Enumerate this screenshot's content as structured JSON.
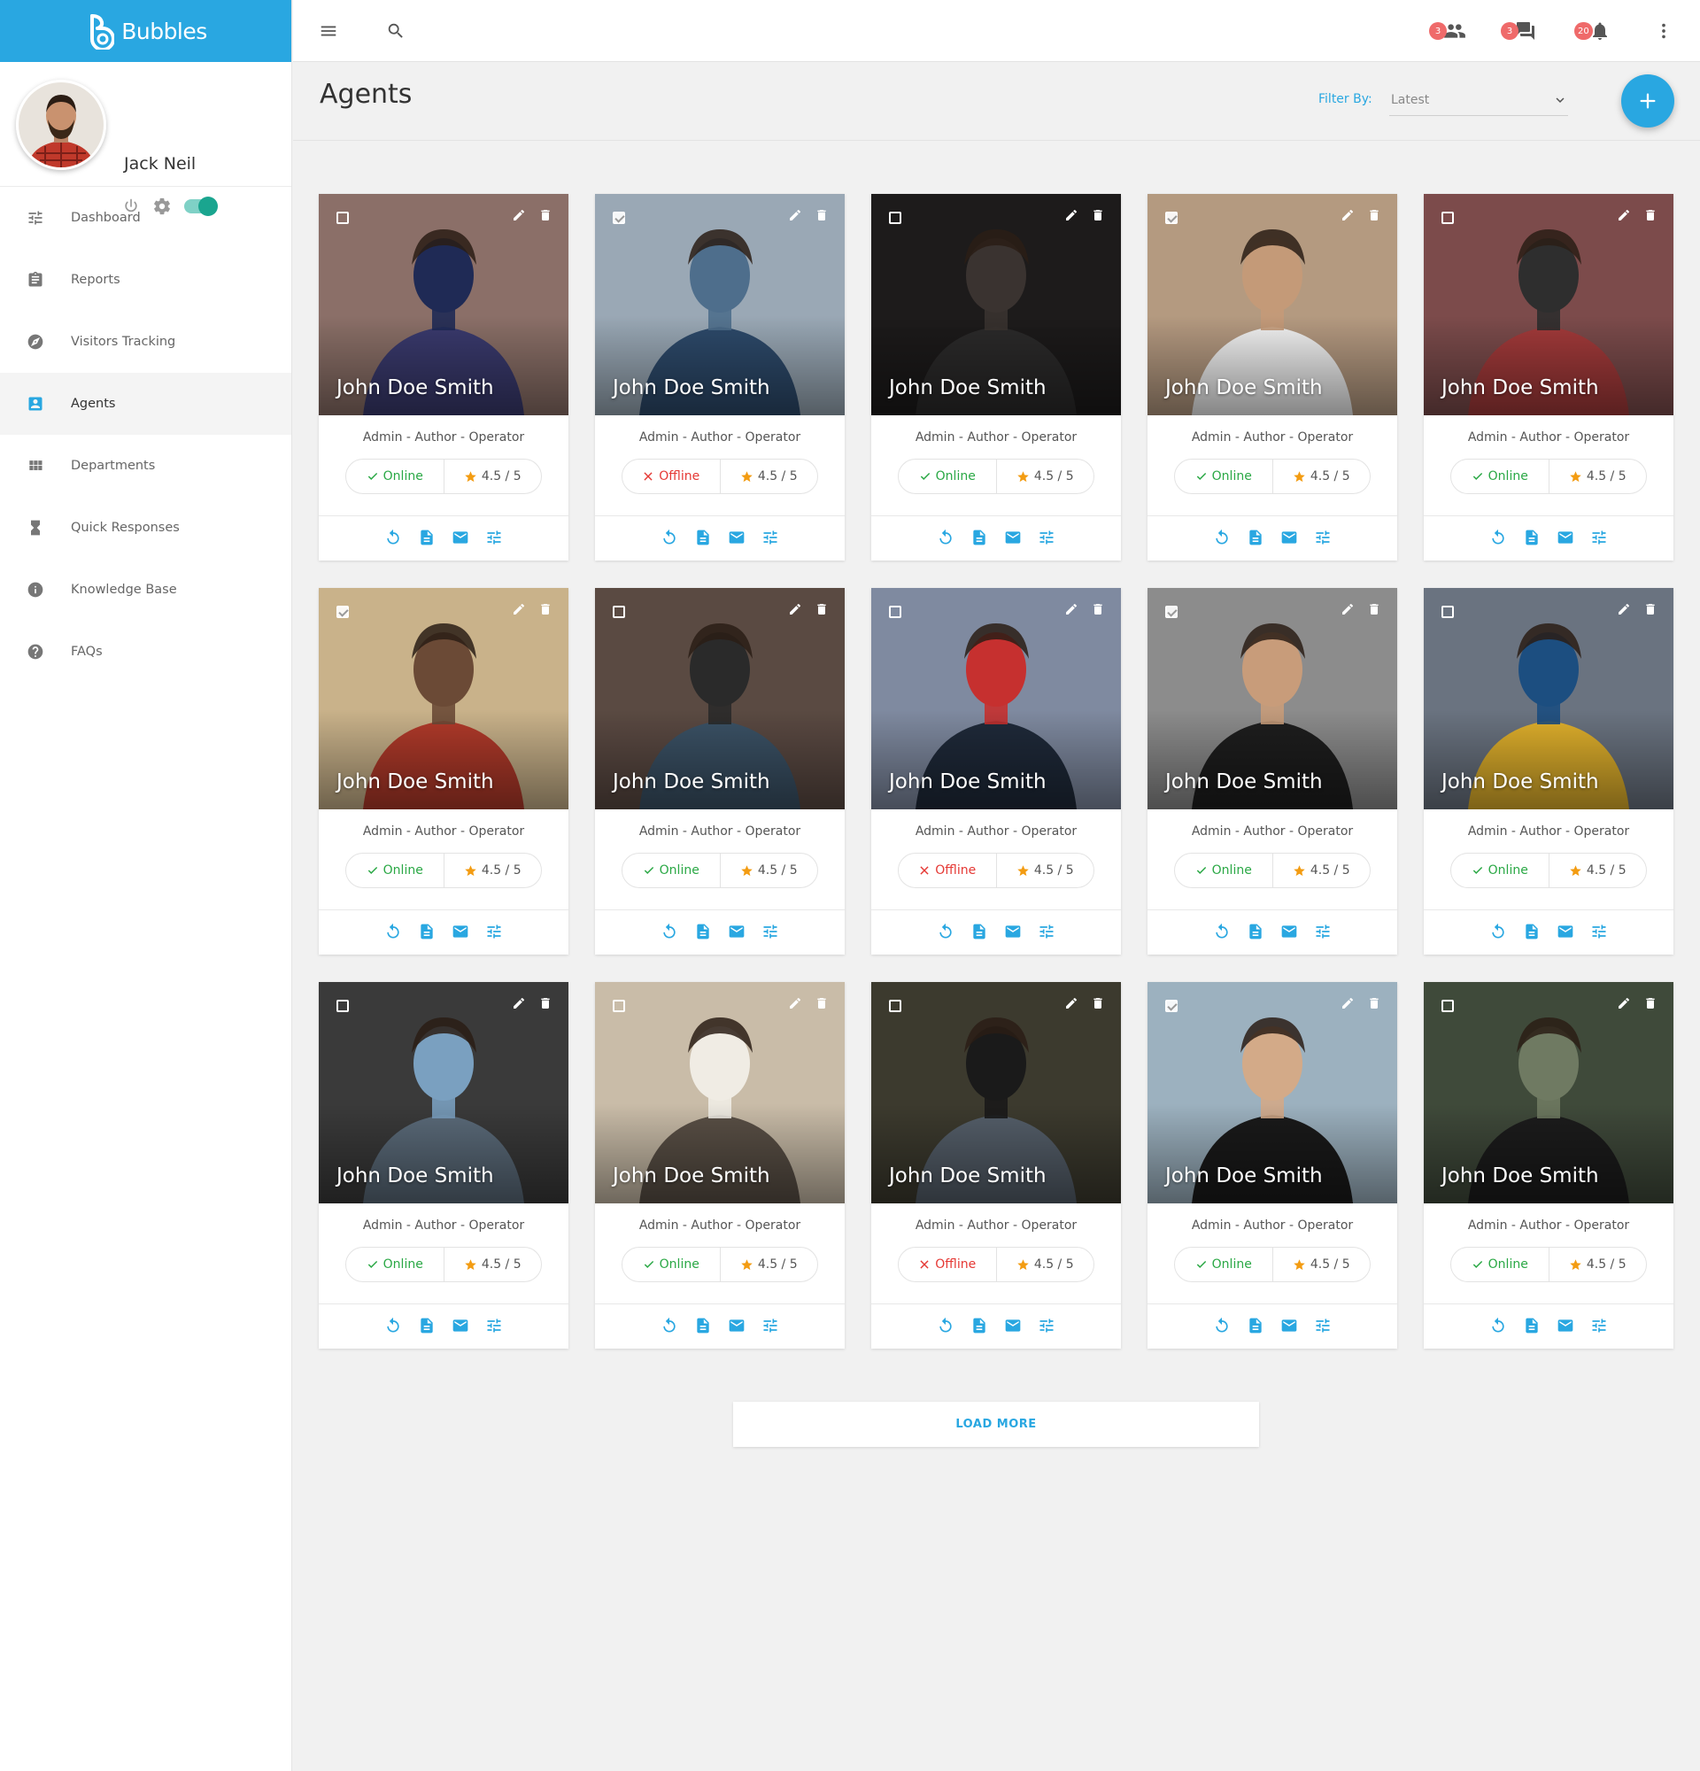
{
  "brand": {
    "name": "Bubbles"
  },
  "user": {
    "name": "Jack Neil",
    "status_toggle": "on"
  },
  "nav": [
    {
      "label": "Dashboard",
      "icon": "sliders-icon",
      "active": false
    },
    {
      "label": "Reports",
      "icon": "clipboard-icon",
      "active": false
    },
    {
      "label": "Visitors Tracking",
      "icon": "compass-icon",
      "active": false
    },
    {
      "label": "Agents",
      "icon": "contact-card-icon",
      "active": true
    },
    {
      "label": "Departments",
      "icon": "grid-icon",
      "active": false
    },
    {
      "label": "Quick Responses",
      "icon": "hourglass-icon",
      "active": false
    },
    {
      "label": "Knowledge Base",
      "icon": "info-icon",
      "active": false
    },
    {
      "label": "FAQs",
      "icon": "help-icon",
      "active": false
    }
  ],
  "topbar": {
    "notifications": [
      {
        "count": "3",
        "icon": "people-icon"
      },
      {
        "count": "3",
        "icon": "chat-icon"
      },
      {
        "count": "20",
        "icon": "bell-icon"
      }
    ]
  },
  "page": {
    "title": "Agents",
    "filter_label": "Filter By:",
    "filter_value": "Latest"
  },
  "colors": {
    "accent": "#29a7e1",
    "online": "#2aa845",
    "offline": "#e53935",
    "star": "#f39c12"
  },
  "agents": [
    {
      "name": "John Doe Smith",
      "role": "Admin - Author - Operator",
      "status": "Online",
      "rating": "4.5 / 5",
      "checked": false
    },
    {
      "name": "John Doe Smith",
      "role": "Admin - Author - Operator",
      "status": "Offline",
      "rating": "4.5 / 5",
      "checked": true
    },
    {
      "name": "John Doe Smith",
      "role": "Admin - Author - Operator",
      "status": "Online",
      "rating": "4.5 / 5",
      "checked": false
    },
    {
      "name": "John Doe Smith",
      "role": "Admin - Author - Operator",
      "status": "Online",
      "rating": "4.5 / 5",
      "checked": true
    },
    {
      "name": "John Doe Smith",
      "role": "Admin - Author - Operator",
      "status": "Online",
      "rating": "4.5 / 5",
      "checked": false
    },
    {
      "name": "John Doe Smith",
      "role": "Admin - Author - Operator",
      "status": "Online",
      "rating": "4.5 / 5",
      "checked": true
    },
    {
      "name": "John Doe Smith",
      "role": "Admin - Author - Operator",
      "status": "Online",
      "rating": "4.5 / 5",
      "checked": false
    },
    {
      "name": "John Doe Smith",
      "role": "Admin - Author - Operator",
      "status": "Offline",
      "rating": "4.5 / 5",
      "checked": false
    },
    {
      "name": "John Doe Smith",
      "role": "Admin - Author - Operator",
      "status": "Online",
      "rating": "4.5 / 5",
      "checked": true
    },
    {
      "name": "John Doe Smith",
      "role": "Admin - Author - Operator",
      "status": "Online",
      "rating": "4.5 / 5",
      "checked": false
    },
    {
      "name": "John Doe Smith",
      "role": "Admin - Author - Operator",
      "status": "Online",
      "rating": "4.5 / 5",
      "checked": false
    },
    {
      "name": "John Doe Smith",
      "role": "Admin - Author - Operator",
      "status": "Online",
      "rating": "4.5 / 5",
      "checked": false
    },
    {
      "name": "John Doe Smith",
      "role": "Admin - Author - Operator",
      "status": "Offline",
      "rating": "4.5 / 5",
      "checked": false
    },
    {
      "name": "John Doe Smith",
      "role": "Admin - Author - Operator",
      "status": "Online",
      "rating": "4.5 / 5",
      "checked": true
    },
    {
      "name": "John Doe Smith",
      "role": "Admin - Author - Operator",
      "status": "Online",
      "rating": "4.5 / 5",
      "checked": false
    }
  ],
  "load_more": "LOAD MORE"
}
